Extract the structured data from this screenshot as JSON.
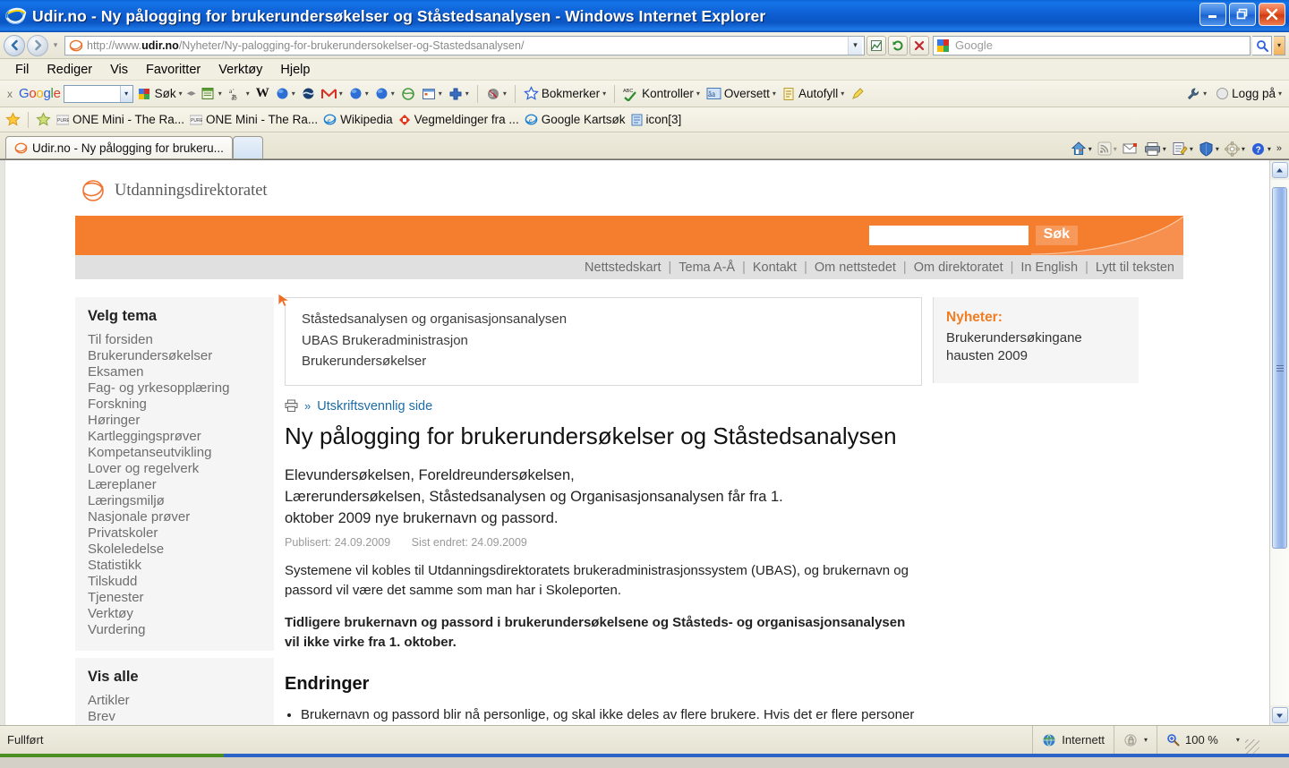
{
  "window": {
    "title": "Udir.no - Ny pålogging for brukerundersøkelser og Ståstedsanalysen - Windows Internet Explorer",
    "minimize_label": "Minimer",
    "maximize_label": "Gjenopprett",
    "close_label": "Lukk"
  },
  "address_bar": {
    "url_scheme": "http://www.",
    "url_domain": "udir.no",
    "url_path": "/Nyheter/Ny-palogging-for-brukerundersokelser-og-Stastedsanalysen/",
    "search_placeholder": "Google",
    "buttons": {
      "back": "Tilbake",
      "forward": "Fremover",
      "compat": "Kompatibilitetsvisning",
      "refresh": "Oppdater",
      "stop": "Stopp",
      "go": "Søk"
    }
  },
  "menu": [
    {
      "label": "Fil",
      "accel": "F"
    },
    {
      "label": "Rediger",
      "accel": "R"
    },
    {
      "label": "Vis",
      "accel": "V"
    },
    {
      "label": "Favoritter",
      "accel": "a"
    },
    {
      "label": "Verktøy",
      "accel": "k"
    },
    {
      "label": "Hjelp",
      "accel": "H"
    }
  ],
  "google_toolbar": {
    "close_label": "x",
    "brand": "Google",
    "search_value": "",
    "items": [
      {
        "label": "Søk",
        "icon": "google-search-icon"
      },
      {
        "label": "",
        "icon": "bookmarks-list-icon"
      },
      {
        "label": "",
        "icon": "translate-icon"
      },
      {
        "label": "",
        "icon": "wikipedia-icon"
      },
      {
        "label": "",
        "icon": "blue-ball-icon"
      },
      {
        "label": "",
        "icon": "dark-ball-icon"
      },
      {
        "label": "",
        "icon": "gmail-icon"
      },
      {
        "label": "",
        "icon": "blue-ball2-icon"
      },
      {
        "label": "",
        "icon": "blue-ball3-icon"
      },
      {
        "label": "",
        "icon": "globe-green-icon"
      },
      {
        "label": "",
        "icon": "calendar-icon"
      },
      {
        "label": "",
        "icon": "plus-icon"
      },
      {
        "label": "",
        "icon": "stumble-icon"
      }
    ],
    "bookmarks_label": "Bokmerker",
    "kontroller_label": "Kontroller",
    "oversett_label": "Oversett",
    "autofyll_label": "Autofyll",
    "highlight_label": "Uthev",
    "settings_label": "Innstillinger",
    "signin_label": "Logg på"
  },
  "favorites_bar": [
    {
      "label": "ONE Mini - The Ra...",
      "icon": "pure-icon"
    },
    {
      "label": "ONE Mini - The Ra...",
      "icon": "pure-icon"
    },
    {
      "label": "Wikipedia",
      "icon": "ie-page-icon"
    },
    {
      "label": "Vegmeldinger fra ...",
      "icon": "red-icon"
    },
    {
      "label": "Google Kartsøk",
      "icon": "ie-page-icon"
    },
    {
      "label": "icon[3]",
      "icon": "blue-page-icon"
    }
  ],
  "tabs": {
    "active": "Udir.no - Ny pålogging for brukeru...",
    "new_tab_label": "Ny fane",
    "tools": [
      {
        "name": "home-icon",
        "label": "Hjem"
      },
      {
        "name": "rss-icon",
        "label": "Feeds"
      },
      {
        "name": "mail-icon",
        "label": "Les e-post"
      },
      {
        "name": "print-icon",
        "label": "Skriv ut"
      },
      {
        "name": "page-icon",
        "label": "Side"
      },
      {
        "name": "safety-icon",
        "label": "Sikkerhet"
      },
      {
        "name": "tools-icon",
        "label": "Verktøy"
      },
      {
        "name": "help-icon",
        "label": "Hjelp"
      },
      {
        "name": "overflow-icon",
        "label": "»"
      }
    ]
  },
  "site": {
    "logo_text": "Utdanningsdirektoratet",
    "search_value": "",
    "search_button": "Søk",
    "top_nav": [
      "Nettstedskart",
      "Tema A-Å",
      "Kontakt",
      "Om nettstedet",
      "Om direktoratet",
      "In English",
      "Lytt til teksten"
    ],
    "sidebar": {
      "heading": "Velg tema",
      "items": [
        "Til forsiden",
        "Brukerundersøkelser",
        "Eksamen",
        "Fag- og yrkesopplæring",
        "Forskning",
        "Høringer",
        "Kartleggingsprøver",
        "Kompetanseutvikling",
        "Lover og regelverk",
        "Læreplaner",
        "Læringsmiljø",
        "Nasjonale prøver",
        "Privatskoler",
        "Skoleledelse",
        "Statistikk",
        "Tilskudd",
        "Tjenester",
        "Verktøy",
        "Vurdering"
      ],
      "show_all_heading": "Vis alle",
      "show_all_items": [
        "Artikler",
        "Brev"
      ]
    },
    "breadcrumb": [
      "Ståstedsanalysen og organisasjonsanalysen",
      "UBAS Brukeradministrasjon",
      "Brukerundersøkelser"
    ],
    "print_link": "Utskriftsvennlig side",
    "article": {
      "title": "Ny pålogging for brukerundersøkelser og Ståstedsanalysen",
      "lead_line1": "Elevundersøkelsen, Foreldreundersøkelsen,",
      "lead_line2": "Lærerundersøkelsen, Ståstedsanalysen og Organisasjonsanalysen får fra 1.",
      "lead_line3": "oktober 2009 nye brukernavn og passord.",
      "published_label": "Publisert: 24.09.2009",
      "modified_label": "Sist endret: 24.09.2009",
      "para1": "Systemene vil kobles til Utdanningsdirektoratets brukeradministrasjonssystem (UBAS), og brukernavn og passord vil være det samme som man har i Skoleporten.",
      "para2_bold": "Tidligere brukernavn og passord i brukerundersøkelsene og Ståsteds- og organisasjonsanalysen vil ikke virke fra 1. oktober.",
      "section_heading": "Endringer",
      "bullets": [
        "Brukernavn og passord blir nå personlige, og skal ikke deles av flere brukere. Hvis det er flere personer ved en skole, skoleeier eller hos Fylkesmannen som skal ha tilgang, må"
      ]
    },
    "news": {
      "heading": "Nyheter:",
      "item": "Brukerundersøkingane hausten 2009"
    }
  },
  "status_bar": {
    "text": "Fullført",
    "zone": "Internett",
    "zoom": "100 %"
  },
  "colors": {
    "brand_orange": "#f47d2e",
    "news_orange": "#f07d22",
    "link_blue": "#1b6ca8",
    "titlebar_blue": "#0d5ed2"
  }
}
